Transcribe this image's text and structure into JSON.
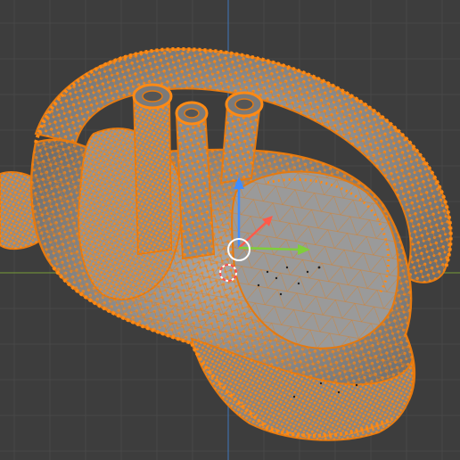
{
  "viewport": {
    "background_color": "#3d3d3d",
    "grid_color": "#484848",
    "x_axis_color": "#6b8a3a",
    "y_axis_color": "#3f6fa8",
    "grid_visible": true
  },
  "mesh": {
    "mode": "edit",
    "selection": "all",
    "surface_color": "#8e8e8e",
    "shadow_color": "#6f6f6f",
    "highlight_color": "#a8a8a8",
    "wire_color": "#e57a10",
    "vertex_color": "#ff8a14"
  },
  "gizmo": {
    "type": "translate",
    "x_color": "#7fcf3a",
    "y_color": "#3f8cff",
    "z_color": "#ff5a4a",
    "pivot_color": "#ffffff"
  },
  "cursor_3d": {
    "icon": "crosshair-cursor-icon",
    "ring_color": "#ff4d4d"
  }
}
